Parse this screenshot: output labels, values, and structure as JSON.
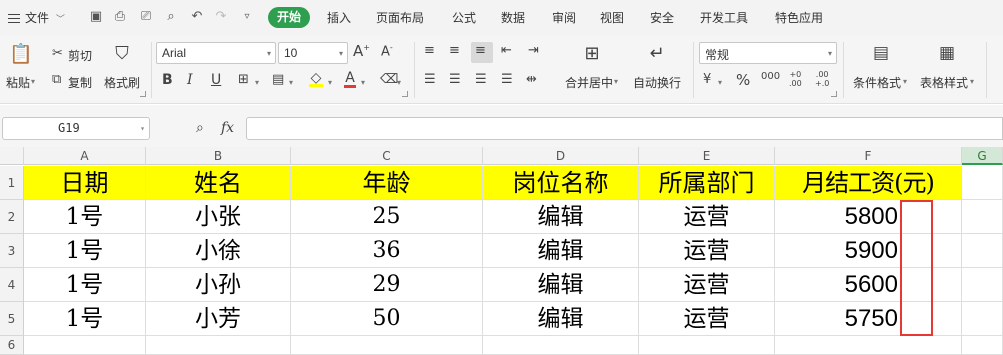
{
  "menubar": {
    "file_label": "文件",
    "active_tab": "开始",
    "tabs": [
      "插入",
      "页面布局",
      "公式",
      "数据",
      "审阅",
      "视图",
      "安全",
      "开发工具",
      "特色应用"
    ]
  },
  "ribbon": {
    "paste_label": "粘贴",
    "cut_label": "剪切",
    "copy_label": "复制",
    "format_painter_label": "格式刷",
    "font_name": "Arial",
    "font_size": "10",
    "merge_center_label": "合并居中",
    "wrap_text_label": "自动换行",
    "number_format": "常规",
    "conditional_format_label": "条件格式",
    "table_style_label": "表格样式",
    "accent_color": "#2e9e4f"
  },
  "formula_bar": {
    "cell_ref": "G19",
    "fx_label": "fx",
    "formula": ""
  },
  "sheet": {
    "columns": [
      "A",
      "B",
      "C",
      "D",
      "E",
      "F",
      "G"
    ],
    "rows": [
      "1",
      "2",
      "3",
      "4",
      "5",
      "6"
    ],
    "header_fill": "#ffff00",
    "highlight_color": "#e53935",
    "headers": [
      "日期",
      "姓名",
      "年龄",
      "岗位名称",
      "所属部门",
      "月结工资(元)"
    ],
    "data": [
      [
        "1号",
        "小张",
        "25",
        "编辑",
        "运营",
        "5800"
      ],
      [
        "1号",
        "小徐",
        "36",
        "编辑",
        "运营",
        "5900"
      ],
      [
        "1号",
        "小孙",
        "29",
        "编辑",
        "运营",
        "5600"
      ],
      [
        "1号",
        "小芳",
        "50",
        "编辑",
        "运营",
        "5750"
      ]
    ]
  }
}
